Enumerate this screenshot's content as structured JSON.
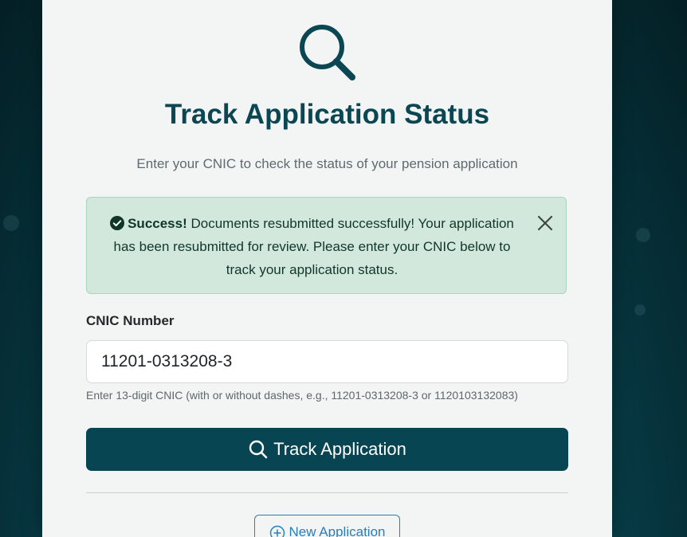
{
  "header": {
    "icon": "search-icon",
    "title": "Track Application Status",
    "subtitle": "Enter your CNIC to check the status of your pension application"
  },
  "alert": {
    "icon": "check-circle-icon",
    "strong": "Success!",
    "message": "Documents resubmitted successfully! Your application has been resubmitted for review. Please enter your CNIC below to track your application status.",
    "close_icon": "close-icon",
    "color": "#d3e8dd"
  },
  "form": {
    "cnic_label": "CNIC Number",
    "cnic_value": "11201-0313208-3",
    "cnic_help": "Enter 13-digit CNIC (with or without dashes, e.g., 11201-0313208-3 or 1120103132083)",
    "track_label": "Track Application",
    "track_icon": "search-icon",
    "primary_color": "#084553"
  },
  "footer": {
    "new_label": "New Application",
    "new_icon": "plus-circle-icon",
    "link_color": "#2a7fb8"
  }
}
